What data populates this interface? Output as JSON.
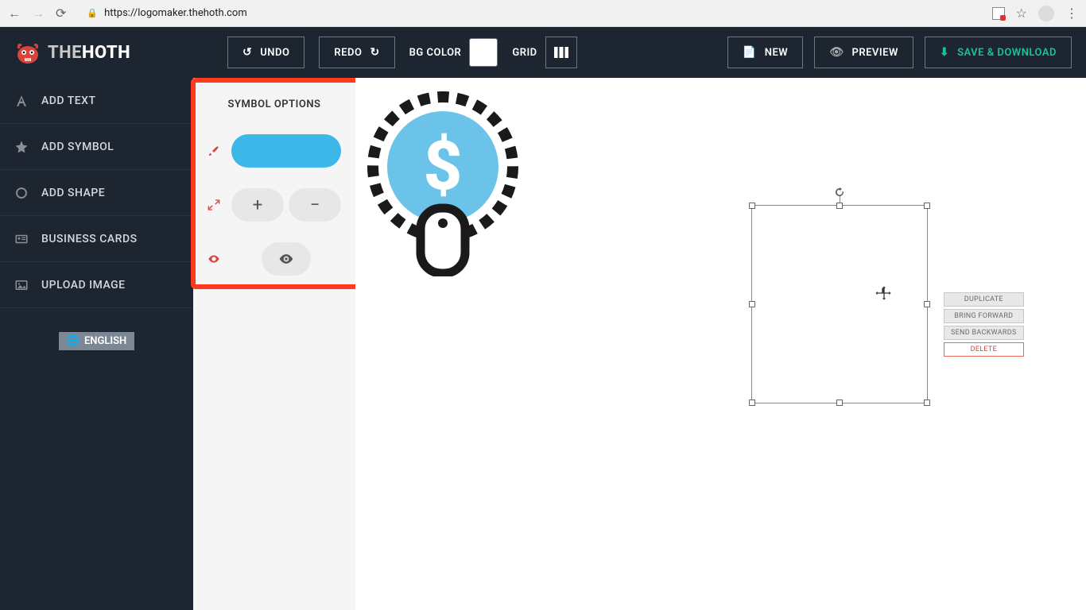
{
  "browser": {
    "url": "https://logomaker.thehoth.com"
  },
  "logo": {
    "brand_the": "THE",
    "brand_hoth": "HOTH"
  },
  "toolbar": {
    "undo": "UNDO",
    "redo": "REDO",
    "bg_color_label": "BG COLOR",
    "grid_label": "GRID",
    "new": "NEW",
    "preview": "PREVIEW",
    "save_download": "SAVE & DOWNLOAD"
  },
  "left_nav": {
    "items": [
      {
        "label": "ADD TEXT"
      },
      {
        "label": "ADD SYMBOL"
      },
      {
        "label": "ADD SHAPE"
      },
      {
        "label": "BUSINESS CARDS"
      },
      {
        "label": "UPLOAD IMAGE"
      }
    ],
    "language": "ENGLISH"
  },
  "options": {
    "title": "SYMBOL OPTIONS",
    "plus": "+",
    "minus": "−",
    "color": "#3db6e8"
  },
  "context_menu": {
    "duplicate": "DUPLICATE",
    "bring_forward": "BRING FORWARD",
    "send_backwards": "SEND BACKWARDS",
    "delete": "DELETE"
  }
}
